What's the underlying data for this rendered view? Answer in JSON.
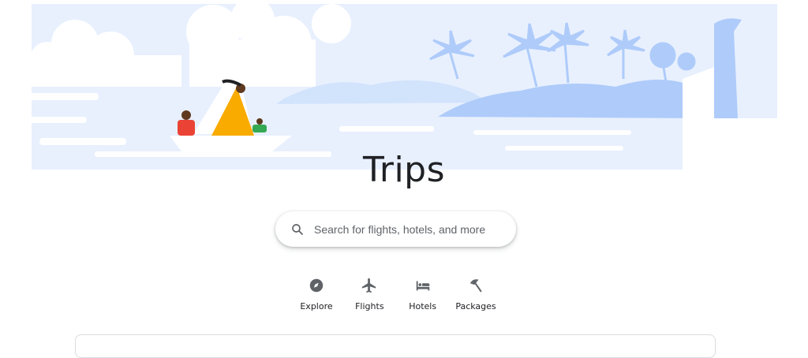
{
  "page": {
    "title": "Trips"
  },
  "search": {
    "placeholder": "Search for flights, hotels, and more"
  },
  "nav": {
    "items": [
      {
        "label": "Explore",
        "icon": "compass-icon"
      },
      {
        "label": "Flights",
        "icon": "airplane-icon"
      },
      {
        "label": "Hotels",
        "icon": "bed-icon"
      },
      {
        "label": "Packages",
        "icon": "beach-umbrella-icon"
      }
    ]
  },
  "colors": {
    "sky": "#e8f0fe",
    "land": "#aecbfa",
    "text": "#202124",
    "icon": "#5f6368"
  }
}
